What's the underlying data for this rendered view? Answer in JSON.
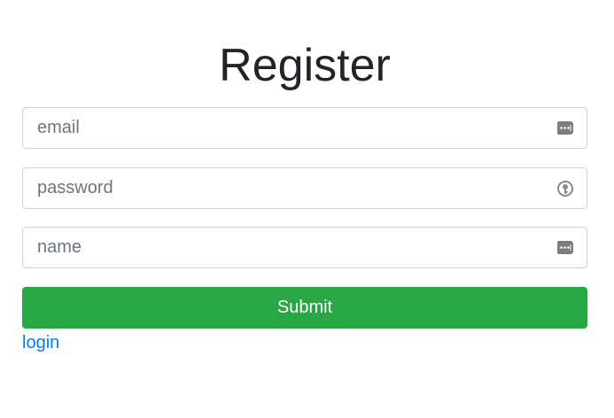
{
  "title": "Register",
  "form": {
    "email": {
      "placeholder": "email",
      "value": "",
      "icon": "password-manager-icon"
    },
    "password": {
      "placeholder": "password",
      "value": "",
      "icon": "password-key-icon"
    },
    "name": {
      "placeholder": "name",
      "value": "",
      "icon": "password-manager-icon"
    },
    "submit_label": "Submit"
  },
  "login_link": "login",
  "colors": {
    "submit_bg": "#28a745",
    "link": "#007bff",
    "title": "#212529",
    "border": "#ced4da"
  }
}
